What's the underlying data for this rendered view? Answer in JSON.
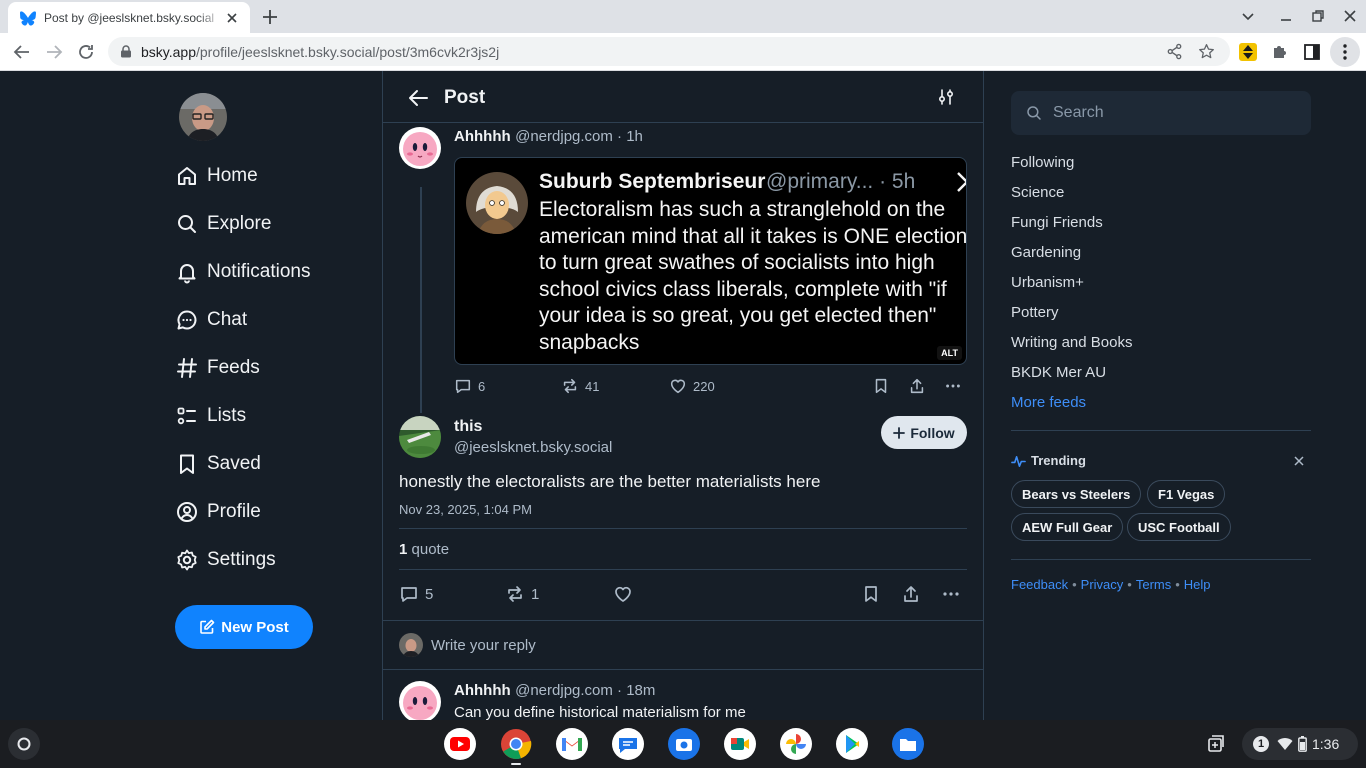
{
  "browser": {
    "tab_title": "Post by @jeeslsknet.bsky.social",
    "url_host": "bsky.app",
    "url_path": "/profile/jeeslsknet.bsky.social/post/3m6cvk2r3js2j"
  },
  "nav": {
    "items": [
      {
        "label": "Home",
        "icon": "home-icon"
      },
      {
        "label": "Explore",
        "icon": "search-icon"
      },
      {
        "label": "Notifications",
        "icon": "bell-icon"
      },
      {
        "label": "Chat",
        "icon": "chat-icon"
      },
      {
        "label": "Feeds",
        "icon": "hash-icon"
      },
      {
        "label": "Lists",
        "icon": "list-icon"
      },
      {
        "label": "Saved",
        "icon": "bookmark-icon"
      },
      {
        "label": "Profile",
        "icon": "user-circle-icon"
      },
      {
        "label": "Settings",
        "icon": "gear-icon"
      }
    ],
    "new_post": "New Post"
  },
  "header": {
    "title": "Post"
  },
  "parent_post": {
    "author": "Ahhhhh",
    "handle": "@nerdjpg.com · 1h",
    "quote": {
      "name": "Suburb Septembriseur",
      "handle": "@primary... · 5h",
      "text": "Electoralism has such a stranglehold on the american mind that all it takes is ONE election to turn great swathes of socialists into high school civics class liberals, complete with \"if your idea is so great, you get elected then\" snapbacks",
      "alt": "ALT"
    },
    "replies": "6",
    "reposts": "41",
    "likes": "220"
  },
  "main_post": {
    "author": "this",
    "handle": "@jeeslsknet.bsky.social",
    "follow": "Follow",
    "text": "honestly the electoralists are the better materialists here",
    "date": "Nov 23, 2025, 1:04 PM",
    "quote_count": "1",
    "quote_label": "quote",
    "replies": "5",
    "reposts": "1"
  },
  "reply_box": {
    "placeholder": "Write your reply"
  },
  "reply_post": {
    "author": "Ahhhhh",
    "handle": "@nerdjpg.com · 18m",
    "text": "Can you define historical materialism for me"
  },
  "sidebar": {
    "search_placeholder": "Search",
    "feeds": [
      "Following",
      "Science",
      "Fungi Friends",
      "Gardening",
      "Urbanism+",
      "Pottery",
      "Writing and Books",
      "BKDK Mer AU"
    ],
    "more_feeds": "More feeds",
    "trending_title": "Trending",
    "trending": [
      "Bears vs Steelers",
      "F1 Vegas",
      "AEW Full Gear",
      "USC Football"
    ],
    "footer": [
      "Feedback",
      "Privacy",
      "Terms",
      "Help"
    ]
  },
  "shelf": {
    "time": "1:36",
    "notification_count": "1"
  },
  "colors": {
    "accent": "#1083fe",
    "background": "#161e27",
    "link": "#3e8ef8"
  }
}
